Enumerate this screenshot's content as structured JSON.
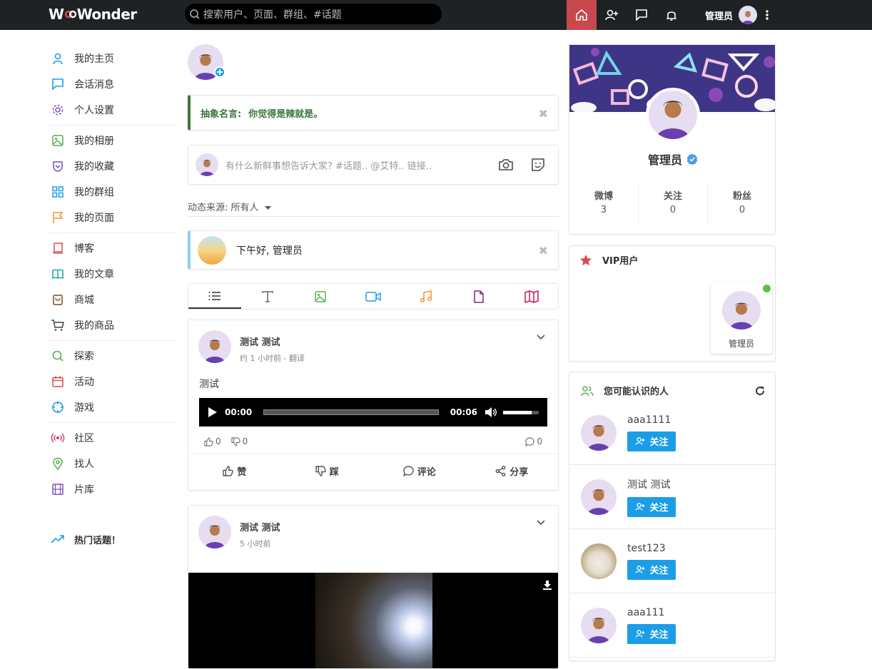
{
  "header": {
    "logo_text_1": "W",
    "logo_text_2": "Wonder",
    "search_placeholder": "搜索用户、页面、群组、#话题",
    "username": "管理员"
  },
  "sidebar": {
    "items": [
      {
        "label": "我的主页",
        "icon": "user-icon",
        "color": "#1b9de8"
      },
      {
        "label": "会话消息",
        "icon": "chat-icon",
        "color": "#1b9de8"
      },
      {
        "label": "个人设置",
        "icon": "gear-icon",
        "color": "#7b4fc1"
      },
      {
        "label": "我的相册",
        "icon": "image-icon",
        "color": "#54b24c"
      },
      {
        "label": "我的收藏",
        "icon": "bookmark-icon",
        "color": "#7b4fc1"
      },
      {
        "label": "我的群组",
        "icon": "grid-icon",
        "color": "#1b9de8"
      },
      {
        "label": "我的页面",
        "icon": "flag-icon",
        "color": "#f0932b"
      },
      {
        "label": "博客",
        "icon": "book-icon",
        "color": "#e0484d"
      },
      {
        "label": "我的文章",
        "icon": "open-book-icon",
        "color": "#17a3a3"
      },
      {
        "label": "商城",
        "icon": "shopping-bag-icon",
        "color": "#7b4f2a"
      },
      {
        "label": "我的商品",
        "icon": "cart-icon",
        "color": "#444444"
      },
      {
        "label": "探索",
        "icon": "search-icon",
        "color": "#54b24c"
      },
      {
        "label": "活动",
        "icon": "calendar-icon",
        "color": "#e0484d"
      },
      {
        "label": "游戏",
        "icon": "crosshair-icon",
        "color": "#1b9de8"
      },
      {
        "label": "社区",
        "icon": "broadcast-icon",
        "color": "#d6336c"
      },
      {
        "label": "找人",
        "icon": "location-icon",
        "color": "#54b24c"
      },
      {
        "label": "片库",
        "icon": "film-icon",
        "color": "#7b4fc1"
      }
    ],
    "trending_label": "热门话题！"
  },
  "feed": {
    "quote_prefix": "抽象名言:",
    "quote_text": "你觉得是辣就是。",
    "composer_placeholder": "有什么新鲜事想告诉大家? #话题.. @艾特.. 链接..",
    "filter_label": "动态来源: 所有人",
    "greeting": "下午好, 管理员",
    "posts": [
      {
        "author": "测试 测试",
        "time": "约 1 小时前",
        "translate": "翻译",
        "text": "测试",
        "audio_current": "00:00",
        "audio_total": "00:06",
        "likes": "0",
        "dislikes": "0",
        "comments": "0",
        "actions": {
          "like": "赞",
          "dislike": "踩",
          "comment": "评论",
          "share": "分享"
        }
      },
      {
        "author": "测试 测试",
        "time": "5 小时前"
      }
    ]
  },
  "profile_card": {
    "name": "管理员",
    "stats": [
      {
        "label": "微博",
        "value": "3"
      },
      {
        "label": "关注",
        "value": "0"
      },
      {
        "label": "粉丝",
        "value": "0"
      }
    ]
  },
  "vip": {
    "title": "VIP用户",
    "user": "管理员"
  },
  "people": {
    "title": "您可能认识的人",
    "follow_label": "关注",
    "list": [
      {
        "name": "aaa1111"
      },
      {
        "name": "测试 测试"
      },
      {
        "name": "test123"
      },
      {
        "name": "aaa111"
      }
    ]
  }
}
